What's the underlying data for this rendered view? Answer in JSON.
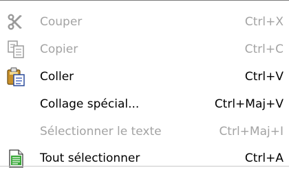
{
  "menu": {
    "items": [
      {
        "label": "Couper",
        "shortcut": "Ctrl+X",
        "enabled": false,
        "icon": "scissors-icon"
      },
      {
        "label": "Copier",
        "shortcut": "Ctrl+C",
        "enabled": false,
        "icon": "copy-icon"
      },
      {
        "label": "Coller",
        "shortcut": "Ctrl+V",
        "enabled": true,
        "icon": "paste-icon"
      },
      {
        "label": "Collage spécial...",
        "shortcut": "Ctrl+Maj+V",
        "enabled": true,
        "icon": ""
      },
      {
        "label": "Sélectionner le texte",
        "shortcut": "Ctrl+Maj+I",
        "enabled": false,
        "icon": ""
      },
      {
        "label": "Tout sélectionner",
        "shortcut": "Ctrl+A",
        "enabled": true,
        "icon": "select-all-icon"
      }
    ]
  },
  "colors": {
    "enabled_text": "#000000",
    "disabled_text": "#a3a3a3",
    "background": "#ffffff"
  }
}
